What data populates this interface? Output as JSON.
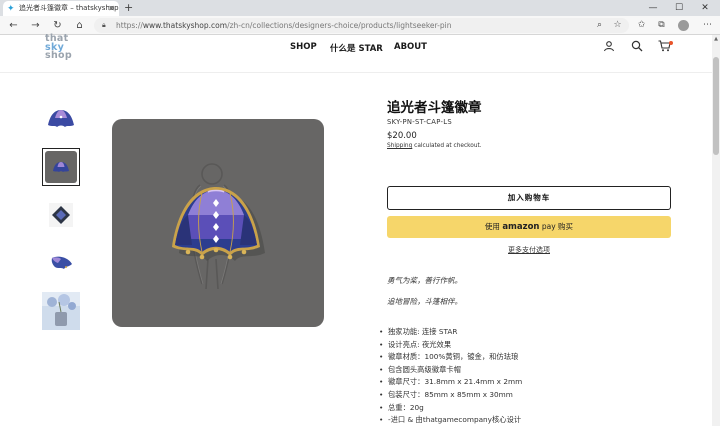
{
  "browser": {
    "tab_title": "追光者斗篷徽章 – thatskyshop",
    "tab_favicon": "sky-star-icon",
    "new_tab_symbol": "+",
    "url_prefix": "https://",
    "url_main": "www.thatskyshop.com",
    "url_path": "/zh-cn/collections/designers-choice/products/lightseeker-pin"
  },
  "header": {
    "logo_lines": [
      "that",
      "sky",
      "shop"
    ],
    "nav": [
      "SHOP",
      "什么是 STAR",
      "ABOUT"
    ],
    "icons": [
      "account-icon",
      "search-icon",
      "cart-icon"
    ],
    "cart_badge_color": "#e8542a"
  },
  "product": {
    "title": "追光者斗篷徽章",
    "sku": "SKY-PN-ST-CAP-LS",
    "price": "$20.00",
    "shipping_link": "Shipping",
    "shipping_text": " calculated at checkout.",
    "add_to_cart": "加入购物车",
    "amazon_prefix": "使用 ",
    "amazon_brand": "amazon",
    "amazon_pay": " pay",
    "amazon_suffix": " 购买",
    "more_payment": "更多支付选项",
    "desc_lines": [
      "勇气为桨，善行作帆。",
      "追地冒险，斗篷相伴。"
    ],
    "features": [
      "独家功能: 连接 STAR",
      "设计亮点: 夜光效果",
      "徽章材质：100%黄铜，镀金，和仿珐琅",
      "包含圆头高级徽章卡帽",
      "徽章尺寸：31.8mm x 21.4mm x 2mm",
      "包装尺寸：85mm x 85mm x 30mm",
      "总重：20g",
      "-进口 & 由thatgamecompany核心设计"
    ]
  },
  "colors": {
    "amazon_button": "#f6d66a",
    "card_gray": "#676665",
    "pin_blue": "#2c3d8f",
    "pin_purple": "#6a5acd",
    "gold": "#c9a24a"
  }
}
